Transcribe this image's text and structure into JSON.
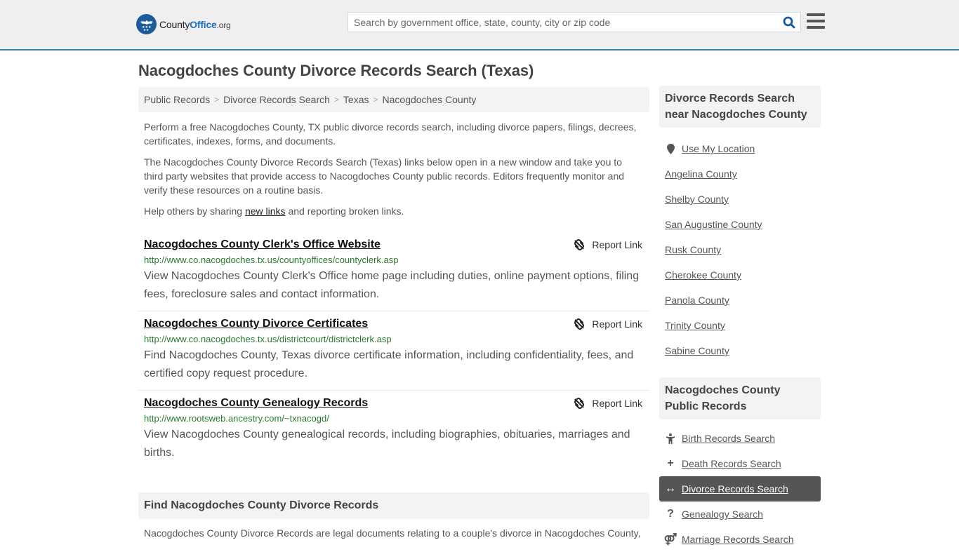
{
  "header": {
    "logo": {
      "name": "CountyOffice",
      "part1": "County",
      "part2": "Office",
      "tld": ".org"
    },
    "search": {
      "placeholder": "Search by government office, state, county, city or zip code",
      "value": ""
    },
    "colors": {
      "brand_blue": "#1f6fb8",
      "header_bg": "#efefef",
      "header_border": "#3d7fb0"
    }
  },
  "page": {
    "title": "Nacogdoches County Divorce Records Search (Texas)"
  },
  "breadcrumb": [
    {
      "label": "Public Records"
    },
    {
      "label": "Divorce Records Search"
    },
    {
      "label": "Texas"
    },
    {
      "label": "Nacogdoches County"
    }
  ],
  "breadcrumb_separator": ">",
  "intro": {
    "p1": "Perform a free Nacogdoches County, TX public divorce records search, including divorce papers, filings, decrees, certificates, indexes, forms, and documents.",
    "p2": "The Nacogdoches County Divorce Records Search (Texas) links below open in a new window and take you to third party websites that provide access to Nacogdoches County public records. Editors frequently monitor and verify these resources on a routine basis.",
    "p3_before": "Help others by sharing ",
    "p3_link": "new links",
    "p3_after": " and reporting broken links."
  },
  "results": [
    {
      "title": "Nacogdoches County Clerk's Office Website",
      "url": "http://www.co.nacogdoches.tx.us/countyoffices/countyclerk.asp",
      "description": "View Nacogdoches County Clerk's Office home page including duties, online payment options, filing fees, foreclosure sales and contact information.",
      "report_label": "Report Link"
    },
    {
      "title": "Nacogdoches County Divorce Certificates",
      "url": "http://www.co.nacogdoches.tx.us/districtcourt/districtclerk.asp",
      "description": "Find Nacogdoches County, Texas divorce certificate information, including confidentiality, fees, and certified copy request procedure.",
      "report_label": "Report Link"
    },
    {
      "title": "Nacogdoches County Genealogy Records",
      "url": "http://www.rootsweb.ancestry.com/~txnacogd/",
      "description": "View Nacogdoches County genealogical records, including biographies, obituaries, marriages and births.",
      "report_label": "Report Link"
    }
  ],
  "find_section": {
    "heading": "Find Nacogdoches County Divorce Records",
    "text": "Nacogdoches County Divorce Records are legal documents relating to a couple's divorce in Nacogdoches County,"
  },
  "sidebar": {
    "nearby": {
      "heading": "Divorce Records Search near Nacogdoches County",
      "use_location": {
        "label": "Use My Location",
        "icon": "map-marker-icon"
      },
      "counties": [
        "Angelina County",
        "Shelby County",
        "San Augustine County",
        "Rusk County",
        "Cherokee County",
        "Panola County",
        "Trinity County",
        "Sabine County"
      ]
    },
    "public_records": {
      "heading": "Nacogdoches County Public Records",
      "items": [
        {
          "label": "Birth Records Search",
          "icon": "child-icon",
          "glyph": "🯅",
          "active": false
        },
        {
          "label": "Death Records Search",
          "icon": "plus-icon",
          "glyph": "+",
          "active": false
        },
        {
          "label": "Divorce Records Search",
          "icon": "arrows-horizontal-icon",
          "glyph": "↔",
          "active": true
        },
        {
          "label": "Genealogy Search",
          "icon": "question-icon",
          "glyph": "?",
          "active": false
        },
        {
          "label": "Marriage Records Search",
          "icon": "marriage-icon",
          "glyph": "⚤",
          "active": false
        }
      ]
    }
  }
}
